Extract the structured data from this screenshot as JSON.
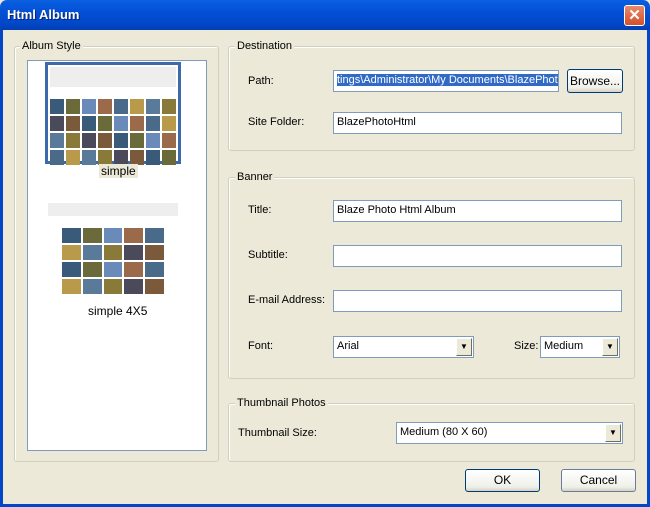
{
  "window": {
    "title": "Html Album"
  },
  "album_style": {
    "label": "Album Style",
    "items": [
      {
        "name": "simple",
        "selected": true
      },
      {
        "name": "simple 4X5",
        "selected": false
      }
    ]
  },
  "destination": {
    "label": "Destination",
    "path_label": "Path:",
    "path_value": "tings\\Administrator\\My Documents\\BlazePhoto",
    "browse": "Browse...",
    "site_folder_label": "Site Folder:",
    "site_folder_value": "BlazePhotoHtml"
  },
  "banner": {
    "label": "Banner",
    "title_label": "Title:",
    "title_value": "Blaze Photo Html Album",
    "subtitle_label": "Subtitle:",
    "subtitle_value": "",
    "email_label": "E-mail Address:",
    "email_value": "",
    "font_label": "Font:",
    "font_value": "Arial",
    "size_label": "Size:",
    "size_value": "Medium"
  },
  "thumbnail": {
    "label": "Thumbnail Photos",
    "size_label": "Thumbnail Size:",
    "size_value": "Medium (80 X 60)"
  },
  "buttons": {
    "ok": "OK",
    "cancel": "Cancel"
  }
}
